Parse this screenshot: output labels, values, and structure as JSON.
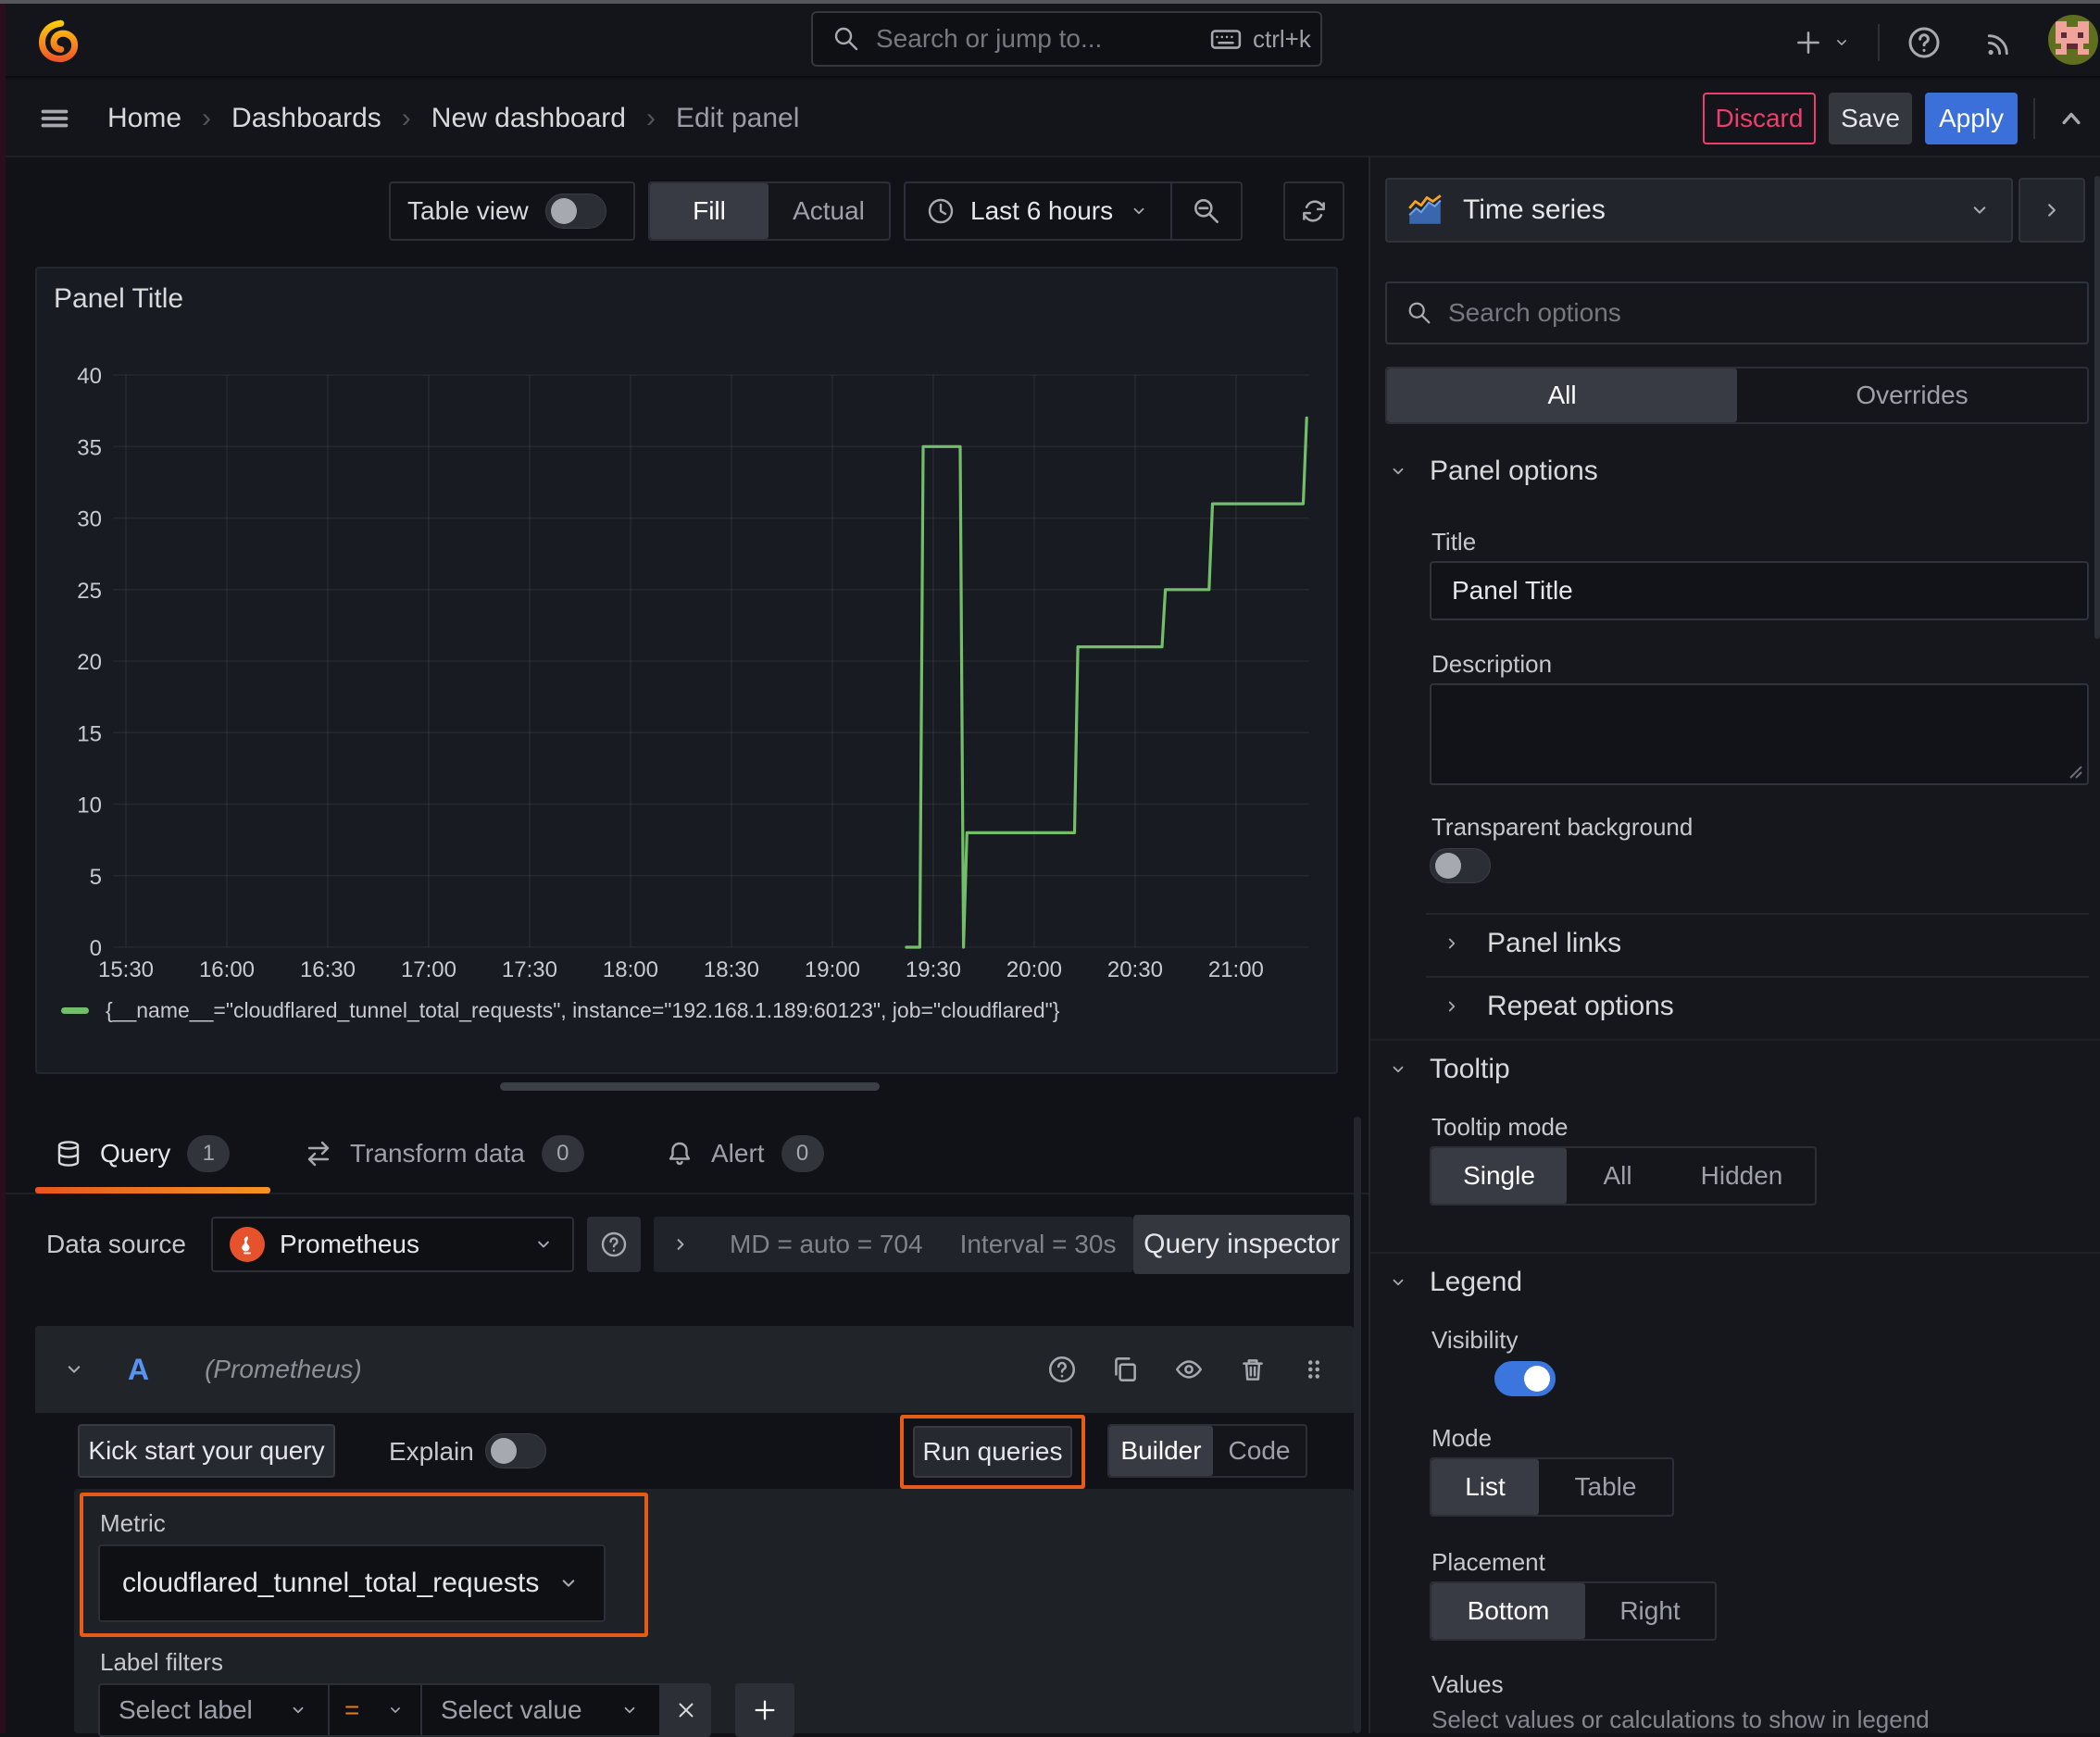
{
  "colors": {
    "accent_orange": "#e55b17",
    "primary_blue": "#3b6fd9",
    "danger_pink": "#ed3e6c",
    "toggle_on_blue": "#3a76dd",
    "series_green": "#73bf69",
    "prometheus_orange": "#e6522c"
  },
  "topbar": {
    "search_placeholder": "Search or jump to...",
    "search_shortcut": "ctrl+k"
  },
  "breadcrumb": {
    "items": [
      "Home",
      "Dashboards",
      "New dashboard"
    ],
    "current": "Edit panel",
    "separator": "›"
  },
  "header_actions": {
    "discard": "Discard",
    "save": "Save",
    "apply": "Apply"
  },
  "panel_toolbar": {
    "table_view_label": "Table view",
    "fill": "Fill",
    "actual": "Actual",
    "time_range": "Last 6 hours"
  },
  "panel": {
    "title": "Panel Title"
  },
  "chart_data": {
    "type": "line",
    "title": "Panel Title",
    "x_unit": "time (minutes after 15:30)",
    "grid": true,
    "legend_position": "bottom",
    "ylim": [
      0,
      40
    ],
    "y_ticks": [
      0,
      5,
      10,
      15,
      20,
      25,
      30,
      35,
      40
    ],
    "x_ticks": [
      {
        "t": 0,
        "label": "15:30"
      },
      {
        "t": 30,
        "label": "16:00"
      },
      {
        "t": 60,
        "label": "16:30"
      },
      {
        "t": 90,
        "label": "17:00"
      },
      {
        "t": 120,
        "label": "17:30"
      },
      {
        "t": 150,
        "label": "18:00"
      },
      {
        "t": 180,
        "label": "18:30"
      },
      {
        "t": 210,
        "label": "19:00"
      },
      {
        "t": 240,
        "label": "19:30"
      },
      {
        "t": 270,
        "label": "20:00"
      },
      {
        "t": 300,
        "label": "20:30"
      },
      {
        "t": 330,
        "label": "21:00"
      }
    ],
    "series": [
      {
        "name": "{__name__=\"cloudflared_tunnel_total_requests\", instance=\"192.168.1.189:60123\", job=\"cloudflared\"}",
        "color": "#73bf69",
        "points": [
          [
            232,
            0
          ],
          [
            236,
            0
          ],
          [
            237,
            35
          ],
          [
            248,
            35
          ],
          [
            249,
            0
          ],
          [
            250,
            8
          ],
          [
            282,
            8
          ],
          [
            283,
            21
          ],
          [
            308,
            21
          ],
          [
            309,
            25
          ],
          [
            322,
            25
          ],
          [
            323,
            31
          ],
          [
            350,
            31
          ],
          [
            351,
            37
          ]
        ]
      }
    ]
  },
  "query_section": {
    "tabs": [
      {
        "label": "Query",
        "count": "1"
      },
      {
        "label": "Transform data",
        "count": "0"
      },
      {
        "label": "Alert",
        "count": "0"
      }
    ],
    "datasource": {
      "label": "Data source",
      "name": "Prometheus",
      "md_summary": "MD = auto = 704",
      "interval_summary": "Interval = 30s",
      "inspector": "Query inspector"
    },
    "query_row": {
      "ref_id": "A",
      "datasource_hint": "(Prometheus)"
    },
    "toolbar": {
      "kick_start": "Kick start your query",
      "explain": "Explain",
      "run_queries": "Run queries",
      "builder": "Builder",
      "code": "Code"
    },
    "metric": {
      "label": "Metric",
      "value": "cloudflared_tunnel_total_requests"
    },
    "label_filters": {
      "label": "Label filters",
      "select_label": "Select label",
      "operator": "=",
      "select_value": "Select value"
    }
  },
  "options_pane": {
    "visualization": "Time series",
    "search_placeholder": "Search options",
    "tabs": {
      "all": "All",
      "overrides": "Overrides"
    },
    "panel_options": {
      "heading": "Panel options",
      "title_label": "Title",
      "title_value": "Panel Title",
      "description_label": "Description",
      "transparent_label": "Transparent background"
    },
    "panel_links": "Panel links",
    "repeat_options": "Repeat options",
    "tooltip": {
      "heading": "Tooltip",
      "mode_label": "Tooltip mode",
      "options": [
        "Single",
        "All",
        "Hidden"
      ],
      "selected": "Single"
    },
    "legend": {
      "heading": "Legend",
      "visibility_label": "Visibility",
      "mode_label": "Mode",
      "mode_options": [
        "List",
        "Table"
      ],
      "mode_selected": "List",
      "placement_label": "Placement",
      "placement_options": [
        "Bottom",
        "Right"
      ],
      "placement_selected": "Bottom",
      "values_label": "Values",
      "values_help": "Select values or calculations to show in legend"
    }
  }
}
